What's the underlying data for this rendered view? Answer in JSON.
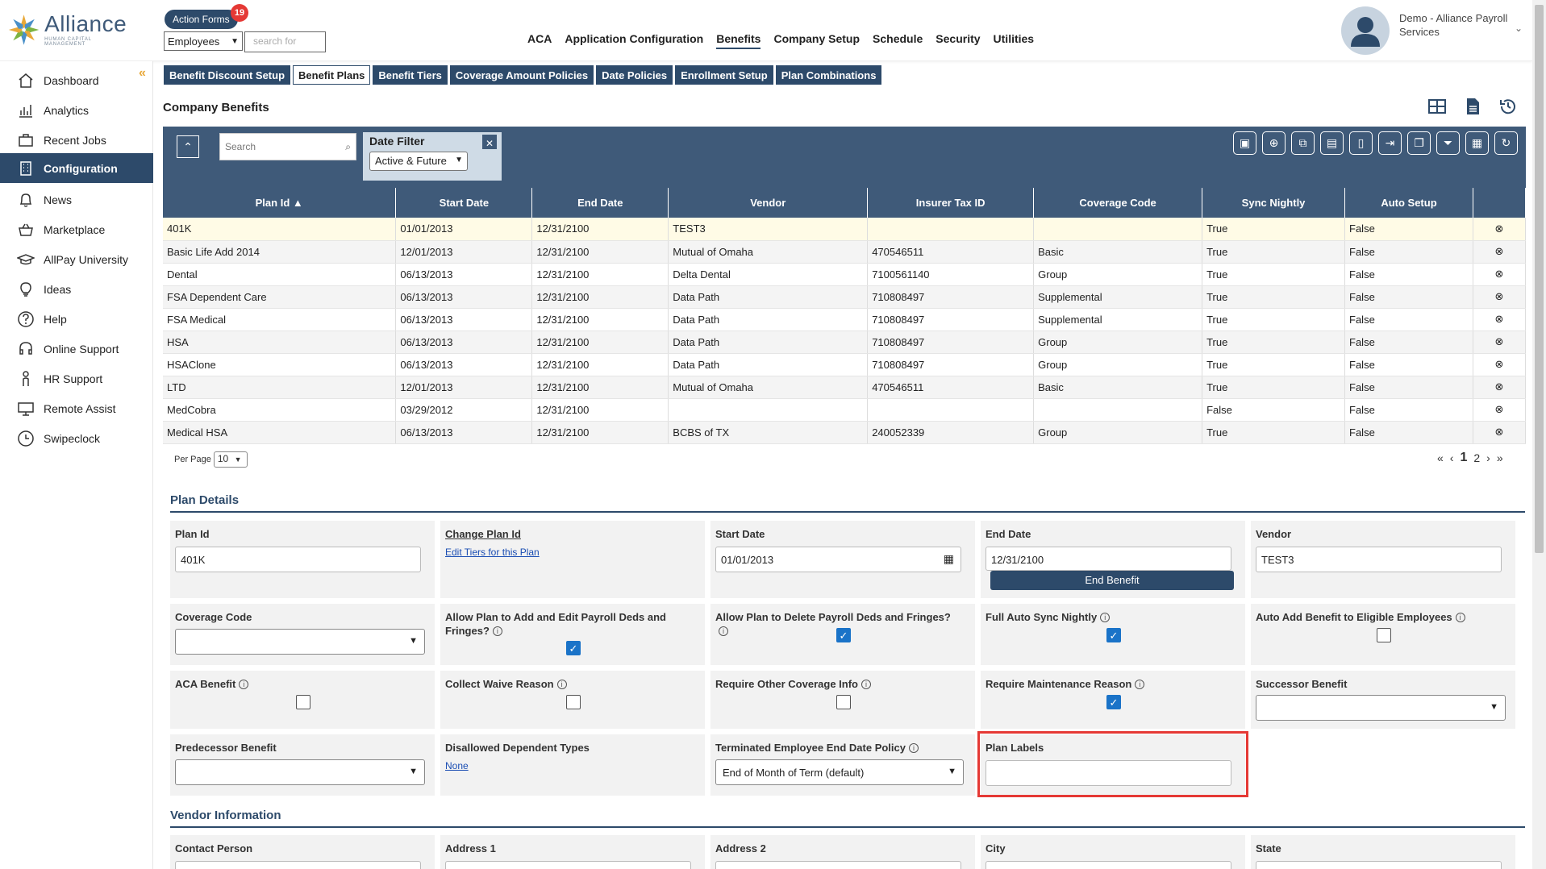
{
  "brand": {
    "name": "Alliance",
    "tagline": "HUMAN CAPITAL MANAGEMENT"
  },
  "header": {
    "action_forms": "Action Forms",
    "action_forms_count": "19",
    "employee_select": "Employees",
    "search_placeholder": "search for",
    "nav": [
      "ACA",
      "Application Configuration",
      "Benefits",
      "Company Setup",
      "Schedule",
      "Security",
      "Utilities"
    ],
    "active_nav": "Benefits",
    "user_name": "Demo - Alliance Payroll Services"
  },
  "sidebar": {
    "items": [
      {
        "label": "Dashboard",
        "icon": "home-icon"
      },
      {
        "label": "Analytics",
        "icon": "analytics-icon"
      },
      {
        "label": "Recent Jobs",
        "icon": "briefcase-icon"
      },
      {
        "label": "Configuration",
        "icon": "building-icon",
        "active": true
      },
      {
        "label": "News",
        "icon": "bell-icon"
      },
      {
        "label": "Marketplace",
        "icon": "basket-icon"
      },
      {
        "label": "AllPay University",
        "icon": "graduation-cap-icon"
      },
      {
        "label": "Ideas",
        "icon": "lightbulb-icon"
      },
      {
        "label": "Help",
        "icon": "question-icon"
      },
      {
        "label": "Online Support",
        "icon": "headset-icon"
      },
      {
        "label": "HR Support",
        "icon": "person-icon"
      },
      {
        "label": "Remote Assist",
        "icon": "monitor-icon"
      },
      {
        "label": "Swipeclock",
        "icon": "clock-icon"
      }
    ]
  },
  "subtabs": [
    "Benefit Discount Setup",
    "Benefit Plans",
    "Benefit Tiers",
    "Coverage Amount Policies",
    "Date Policies",
    "Enrollment Setup",
    "Plan Combinations"
  ],
  "active_subtab": "Benefit Plans",
  "page_title": "Company Benefits",
  "grid": {
    "search_placeholder": "Search",
    "date_filter_label": "Date Filter",
    "date_filter_value": "Active & Future",
    "columns": [
      "Plan Id ▲",
      "Start Date",
      "End Date",
      "Vendor",
      "Insurer Tax ID",
      "Coverage Code",
      "Sync Nightly",
      "Auto Setup"
    ],
    "rows": [
      [
        "401K",
        "01/01/2013",
        "12/31/2100",
        "TEST3",
        "",
        "",
        "True",
        "False"
      ],
      [
        "Basic Life Add 2014",
        "12/01/2013",
        "12/31/2100",
        "Mutual of Omaha",
        "470546511",
        "Basic",
        "True",
        "False"
      ],
      [
        "Dental",
        "06/13/2013",
        "12/31/2100",
        "Delta Dental",
        "7100561140",
        "Group",
        "True",
        "False"
      ],
      [
        "FSA Dependent Care",
        "06/13/2013",
        "12/31/2100",
        "Data Path",
        "710808497",
        "Supplemental",
        "True",
        "False"
      ],
      [
        "FSA Medical",
        "06/13/2013",
        "12/31/2100",
        "Data Path",
        "710808497",
        "Supplemental",
        "True",
        "False"
      ],
      [
        "HSA",
        "06/13/2013",
        "12/31/2100",
        "Data Path",
        "710808497",
        "Group",
        "True",
        "False"
      ],
      [
        "HSAClone",
        "06/13/2013",
        "12/31/2100",
        "Data Path",
        "710808497",
        "Group",
        "True",
        "False"
      ],
      [
        "LTD",
        "12/01/2013",
        "12/31/2100",
        "Mutual of Omaha",
        "470546511",
        "Basic",
        "True",
        "False"
      ],
      [
        "MedCobra",
        "03/29/2012",
        "12/31/2100",
        "",
        "",
        "",
        "False",
        "False"
      ],
      [
        "Medical HSA",
        "06/13/2013",
        "12/31/2100",
        "BCBS of TX",
        "240052339",
        "Group",
        "True",
        "False"
      ]
    ],
    "per_page_label": "Per Page",
    "per_page_value": "10",
    "current_page": "1",
    "next_page": "2"
  },
  "plan_details": {
    "title": "Plan Details",
    "plan_id_label": "Plan Id",
    "plan_id_value": "401K",
    "change_plan_id": "Change Plan Id",
    "edit_tiers": "Edit Tiers for this Plan",
    "start_date_label": "Start Date",
    "start_date_value": "01/01/2013",
    "end_date_label": "End Date",
    "end_date_value": "12/31/2100",
    "end_benefit_button": "End Benefit",
    "vendor_label": "Vendor",
    "vendor_value": "TEST3",
    "coverage_code_label": "Coverage Code",
    "allow_add_label": "Allow Plan to Add and Edit Payroll Deds and Fringes?",
    "allow_add_checked": true,
    "allow_delete_label": "Allow Plan to Delete Payroll Deds and Fringes?",
    "allow_delete_checked": true,
    "full_auto_sync_label": "Full Auto Sync Nightly",
    "full_auto_sync_checked": true,
    "auto_add_label": "Auto Add Benefit to Eligible Employees",
    "auto_add_checked": false,
    "aca_benefit_label": "ACA Benefit",
    "aca_benefit_checked": false,
    "collect_waive_label": "Collect Waive Reason",
    "collect_waive_checked": false,
    "require_other_label": "Require Other Coverage Info",
    "require_other_checked": false,
    "require_maint_label": "Require Maintenance Reason",
    "require_maint_checked": true,
    "successor_label": "Successor Benefit",
    "predecessor_label": "Predecessor Benefit",
    "disallowed_label": "Disallowed Dependent Types",
    "disallowed_value": "None",
    "terminated_label": "Terminated Employee End Date Policy",
    "terminated_value": "End of Month of Term (default)",
    "plan_labels_label": "Plan Labels",
    "plan_labels_value": ""
  },
  "vendor_info": {
    "title": "Vendor Information",
    "contact_person": "Contact Person",
    "address1": "Address 1",
    "address2": "Address 2",
    "city": "City",
    "state": "State"
  }
}
